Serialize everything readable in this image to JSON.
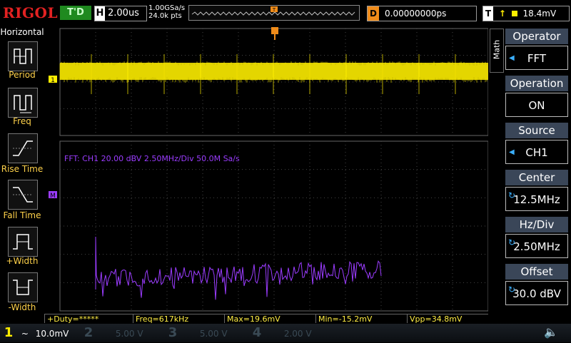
{
  "brand": "RIGOL",
  "top": {
    "trigger_state": "T'D",
    "timebase_key": "H",
    "timebase": "2.00us",
    "sample_rate": "1.00GSa/s",
    "memory_depth": "24.0k pts",
    "delay_key": "D",
    "delay": "0.00000000ps",
    "trigger_key": "T",
    "trigger_level": "18.4mV"
  },
  "left_panel": {
    "title": "Horizontal",
    "items": [
      {
        "label": "Period"
      },
      {
        "label": "Freq"
      },
      {
        "label": "Rise Time"
      },
      {
        "label": "Fall Time"
      },
      {
        "label": "+Width"
      },
      {
        "label": "-Width"
      }
    ]
  },
  "screen": {
    "ch1_marker": "1",
    "math_marker": "M",
    "fft_label": "FFT:  CH1  20.00 dBV    2.50MHz/Div    50.0M Sa/s",
    "math_tab": "Math"
  },
  "right_menu": {
    "items": [
      {
        "title": "Operator",
        "value": "FFT"
      },
      {
        "title": "Operation",
        "value": "ON"
      },
      {
        "title": "Source",
        "value": "CH1"
      },
      {
        "title": "Center",
        "value": "12.5MHz"
      },
      {
        "title": "Hz/Div",
        "value": "2.50MHz"
      },
      {
        "title": "Offset",
        "value": "30.0 dBV"
      }
    ]
  },
  "measurements": {
    "duty": "+Duty=*****",
    "freq": "Freq=617kHz",
    "max": "Max=19.6mV",
    "min": "Min=-15.2mV",
    "vpp": "Vpp=34.8mV"
  },
  "channels": [
    {
      "num": "1",
      "coupling": "~",
      "scale": "10.0mV",
      "color": "#ffee00"
    },
    {
      "num": "2",
      "scale": "5.00 V",
      "color": "#3a4a55"
    },
    {
      "num": "3",
      "scale": "5.00 V",
      "color": "#3a4a55"
    },
    {
      "num": "4",
      "scale": "2.00 V",
      "color": "#3a4a55"
    }
  ],
  "colors": {
    "ch1": "#ffee00",
    "math": "#9b3cff",
    "accent": "#f08c1a",
    "brand": "#e32222"
  }
}
